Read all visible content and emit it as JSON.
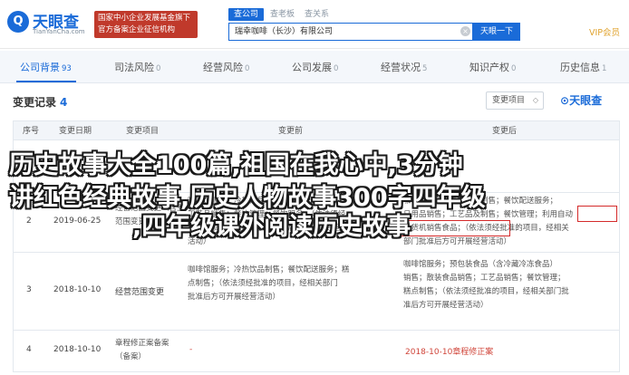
{
  "header": {
    "logo_mark": "Q",
    "logo_name": "天眼查",
    "logo_sub": "TianYanCha.com",
    "badge_line1": "国家中小企业发展基金旗下",
    "badge_line2": "官方备案企业征信机构",
    "search_tabs": [
      "查公司",
      "查老板",
      "查关系"
    ],
    "search_value": "瑞幸咖啡（长沙）有限公司",
    "search_clear": "×",
    "search_button": "天眼一下",
    "vip_label": "VIP会员"
  },
  "tabs": [
    {
      "label": "公司背景",
      "count": "93"
    },
    {
      "label": "司法风险",
      "count": "0"
    },
    {
      "label": "经营风险",
      "count": "0"
    },
    {
      "label": "公司发展",
      "count": "0"
    },
    {
      "label": "经营状况",
      "count": "5"
    },
    {
      "label": "知识产权",
      "count": "0"
    },
    {
      "label": "历史信息",
      "count": "1"
    }
  ],
  "section": {
    "title": "变更记录",
    "count": "4",
    "select_label": "变更项目",
    "brand": "天眼查"
  },
  "table": {
    "headers": [
      "序号",
      "变更日期",
      "变更项目",
      "变更前",
      "变更后"
    ],
    "rows": [
      {
        "index": "1",
        "date": "",
        "item": "",
        "before": [],
        "after": []
      },
      {
        "index": "2",
        "date": "2019-06-25",
        "item_lines": [
          "经营范围变更（含业务",
          "范围变更）"
        ],
        "before": [
          "咖啡馆服务；冷热饮品制售；餐饮配送服务；",
          "工艺品销售；餐饮管理；餐饮服务；（依法须经",
          "批准的项目，经相关部门批准后方可开展经营",
          "活动）"
        ],
        "after": [
          "咖啡馆服务；冷热饮品制售；餐饮配送服务；",
          "日用品销售；工艺品及制售；餐饮管理；利用自动",
          "售货机销售食品；（依法须经批准的项目，经相关",
          "部门批准后方可开展经营活动）"
        ],
        "after_highlight": "利用自动"
      },
      {
        "index": "3",
        "date": "2018-10-10",
        "item": "经营范围变更",
        "before": [
          "咖啡馆服务；冷热饮品制售；餐饮配送服务；糕",
          "点制售；（依法须经批准的项目，经相关部门",
          "批准后方可开展经营活动）"
        ],
        "after": [
          "咖啡馆服务；预包装食品（含冷藏冷冻食品）",
          "销售；散装食品销售；工艺品销售；餐饮管理；",
          "糕点制售；（依法须经批准的项目，经相关部门批",
          "准后方可开展经营活动）"
        ]
      },
      {
        "index": "4",
        "date": "2018-10-10",
        "item_lines": [
          "章程修正案备案",
          "（备案）"
        ],
        "before": [
          "-"
        ],
        "after": [
          "2018-10-10章程修正案"
        ]
      }
    ]
  },
  "overlay": {
    "line1": "历史故事大全100篇,祖国在我心中,3分钟",
    "line2": "讲红色经典故事,历史人物故事300字四年级",
    "line3": ",四年级课外阅读历史故事"
  },
  "colors": {
    "accent": "#1a6bd8",
    "badge_red": "#c0392b",
    "highlight_red": "#d42a2a",
    "vip_gold": "#e0a32e"
  }
}
